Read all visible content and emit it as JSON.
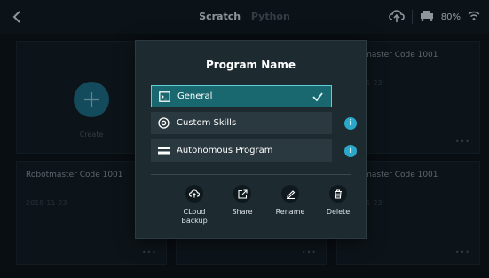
{
  "colors": {
    "accent": "#2aa7c9",
    "selected_bg": "#19686f",
    "selected_border": "#5cd0d6",
    "dialog_bg": "#1d2a30"
  },
  "topbar": {
    "back_icon": "chevron-left-icon",
    "tabs": [
      {
        "label": "Scratch",
        "active": true
      },
      {
        "label": "Python",
        "active": false
      }
    ],
    "cloud_icon": "cloud-upload-icon",
    "battery": "80%",
    "robot_icon": "robot-icon",
    "wifi_icon": "wifi-icon"
  },
  "cards": [
    {
      "title": "Robotmaster Code 1001",
      "date": "2018-11-23"
    },
    {
      "title": "Robotmaster Code 1001",
      "date": "2018-11-23"
    },
    {
      "title": "Robotmaster Code 1001",
      "date": "2018-11-23"
    }
  ],
  "create": {
    "label": "Create"
  },
  "card_menu": "•••",
  "dialog": {
    "title": "Program Name",
    "options": [
      {
        "label": "General",
        "icon": "terminal-icon",
        "selected": true
      },
      {
        "label": "Custom Skills",
        "icon": "skills-icon",
        "selected": false,
        "info": "i"
      },
      {
        "label": "Autonomous Program",
        "icon": "program-icon",
        "selected": false,
        "info": "i"
      }
    ],
    "actions": [
      {
        "label": "CLoud Backup",
        "icon": "cloud-backup-icon"
      },
      {
        "label": "Share",
        "icon": "share-icon"
      },
      {
        "label": "Rename",
        "icon": "rename-icon"
      },
      {
        "label": "Delete",
        "icon": "trash-icon"
      }
    ]
  }
}
